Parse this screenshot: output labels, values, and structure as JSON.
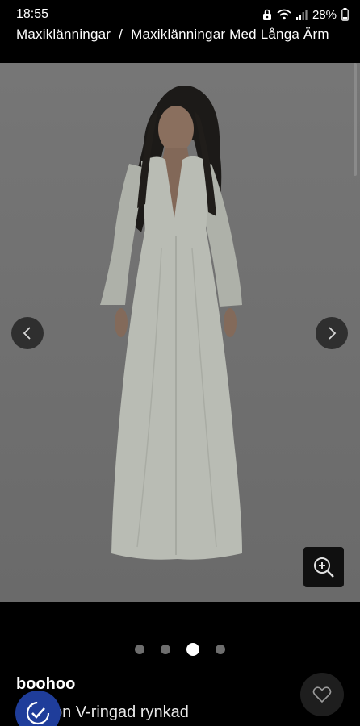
{
  "status_bar": {
    "time": "18:55",
    "battery": "28%",
    "icons": [
      "lock-icon",
      "wifi-icon",
      "signal-icon",
      "battery-icon"
    ]
  },
  "breadcrumb": {
    "items": [
      "Maxiklänningar",
      "Maxiklänningar Med Långa Ärm"
    ],
    "separator": "/"
  },
  "gallery": {
    "image_description_icon": "product-image",
    "dots_total": 4,
    "active_dot_index": 2,
    "prev_icon": "chevron-left-icon",
    "next_icon": "chevron-right-icon",
    "zoom_icon": "zoom-in-icon"
  },
  "product": {
    "brand": "boohoo",
    "name_partial": "on V-ringad rynkad",
    "favorite_icon": "heart-icon"
  },
  "colors": {
    "background": "#000000",
    "image_backdrop": "#6f6f6f",
    "dress": "#b9bcb4",
    "badge": "#1f3d9a"
  }
}
